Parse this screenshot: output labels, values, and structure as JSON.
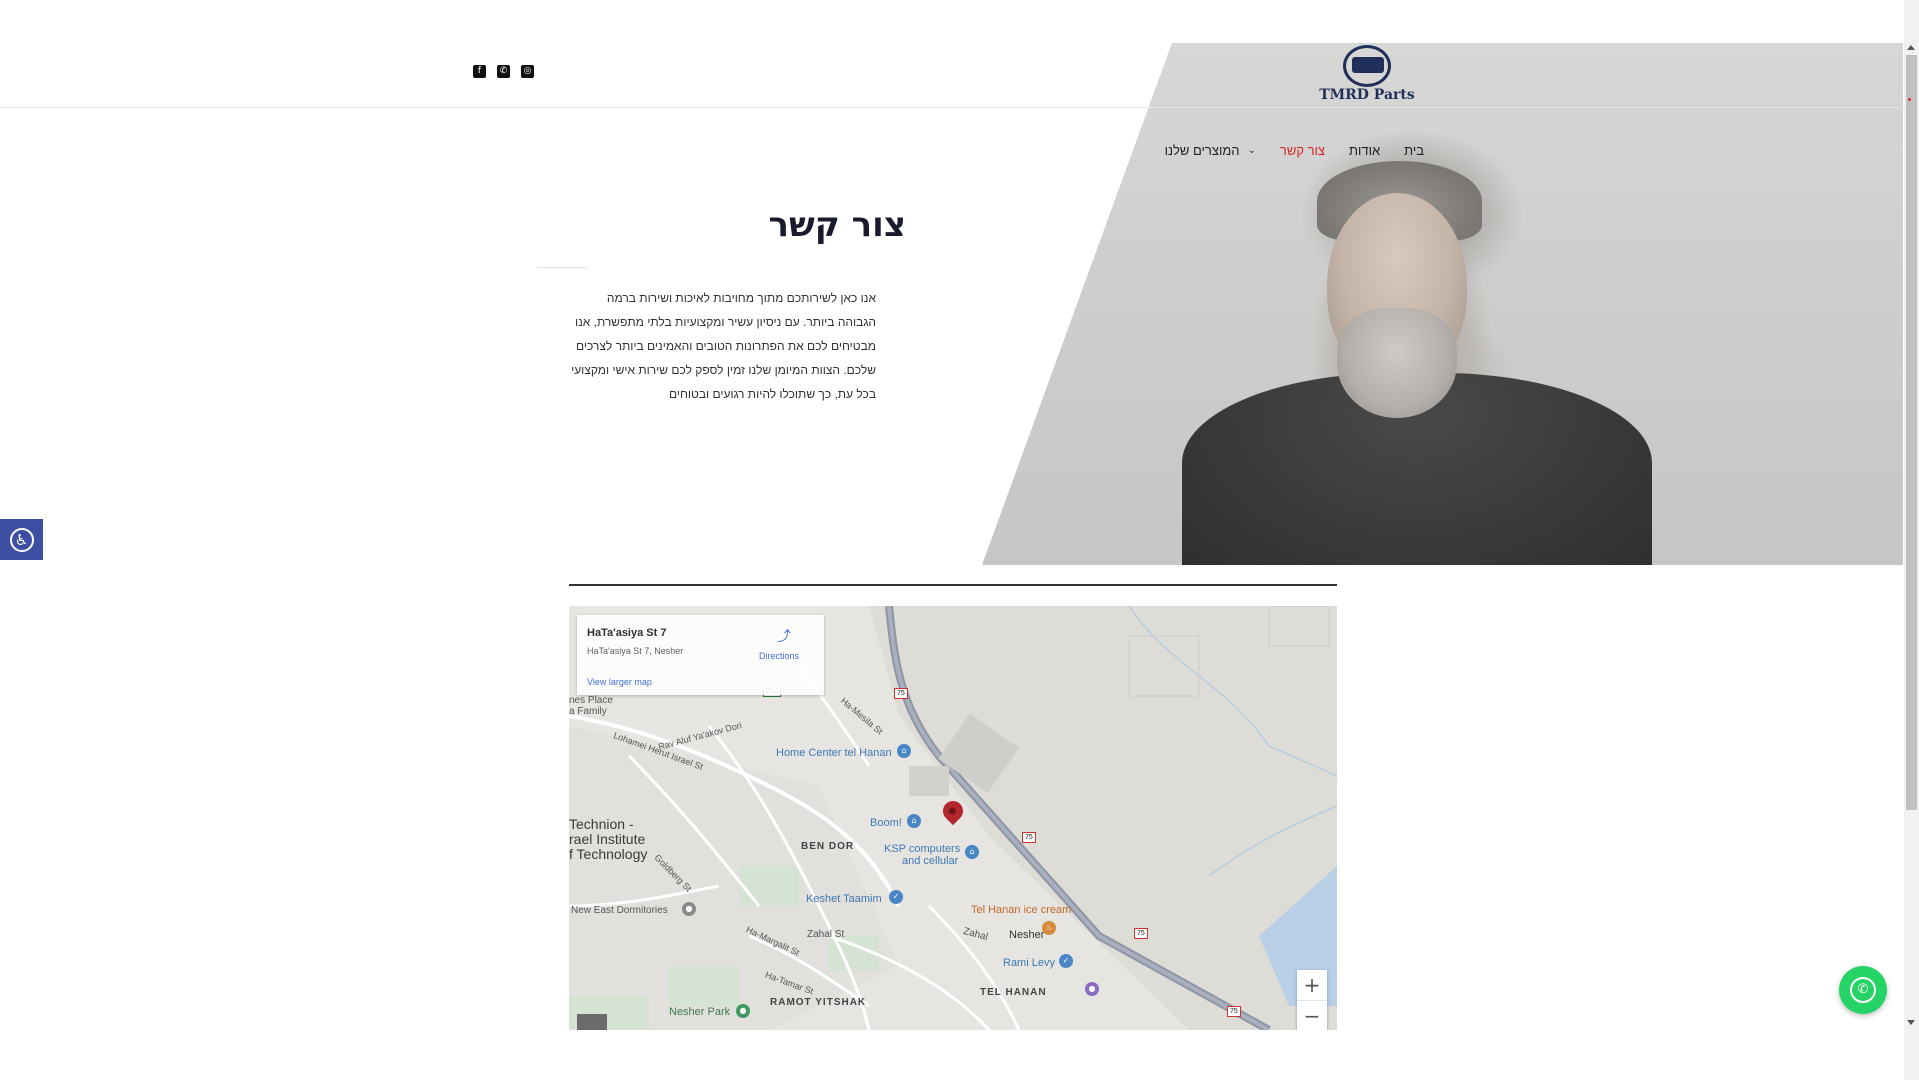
{
  "brand": {
    "logo_text": "TMRD Parts"
  },
  "social": {
    "icons": [
      "instagram-icon",
      "whatsapp-icon",
      "facebook-icon"
    ]
  },
  "nav": {
    "items": [
      {
        "label": "בית"
      },
      {
        "label": "אודות"
      },
      {
        "label": "צור קשר",
        "active": true
      },
      {
        "label": "המוצרים שלנו",
        "has_dropdown": true
      }
    ],
    "active_color": "#d6232a"
  },
  "contact": {
    "title": "צור קשר",
    "lines": [
      "אנו כאן לשירותכם מתוך מחויבות לאיכות ושירות ברמה",
      "הגבוהה ביותר. עם ניסיון עשיר ומקצועיות בלתי מתפשרת, אנו",
      "מבטיחים לכם את הפתרונות הטובים והאמינים ביותר לצרכים",
      "שלכם. הצוות המיומן שלנו זמין לספק לכם שירות אישי ומקצועי",
      "בכל עת, כך שתוכלו להיות רגועים ובטוחים"
    ]
  },
  "map": {
    "card": {
      "place_name": "HaTa'asiya St 7",
      "address": "HaTa'asiya St 7, Nesher",
      "directions_label": "Directions",
      "larger_map_label": "View larger map"
    },
    "labels": {
      "technion_1": "Technion -",
      "technion_2": "rael Institute",
      "technion_3": "f Technology",
      "home_center": "Home Center tel Hanan",
      "boom": "Boom!",
      "ksp_1": "KSP computers",
      "ksp_2": "and cellular",
      "keshet": "Keshet Taamim",
      "tel_hanan_ice": "Tel Hanan ice cream",
      "nesher": "Nesher",
      "rami_levy": "Rami Levy",
      "tel_hanan": "TEL HANAN",
      "ramot_yitshak": "RAMOT YITSHAK",
      "ben_dor": "BEN DOR",
      "nesher_park": "Nesher Park",
      "new_east_dorm": "New East Dormitories",
      "zahal_st": "Zahal St",
      "zahal": "Zahal",
      "rav_aluf": "Rav Aluf Ya'akov Dori",
      "lohamei": "Lohamei Herut Israel St",
      "nes_place_1": "nes Place",
      "nes_place_2": "a Family",
      "ha_masila": "Ha-Mesila St",
      "ha_margalit": "Ha-Margalit St",
      "ha_tamar": "Ha-Tamar St",
      "goldberg": "Goldberg St",
      "route_75": "75",
      "route_752": "752"
    },
    "zoom_in": "+",
    "zoom_out": "−"
  },
  "widgets": {
    "accessibility_icon": "accessibility-icon",
    "whatsapp_icon": "whatsapp-icon"
  }
}
